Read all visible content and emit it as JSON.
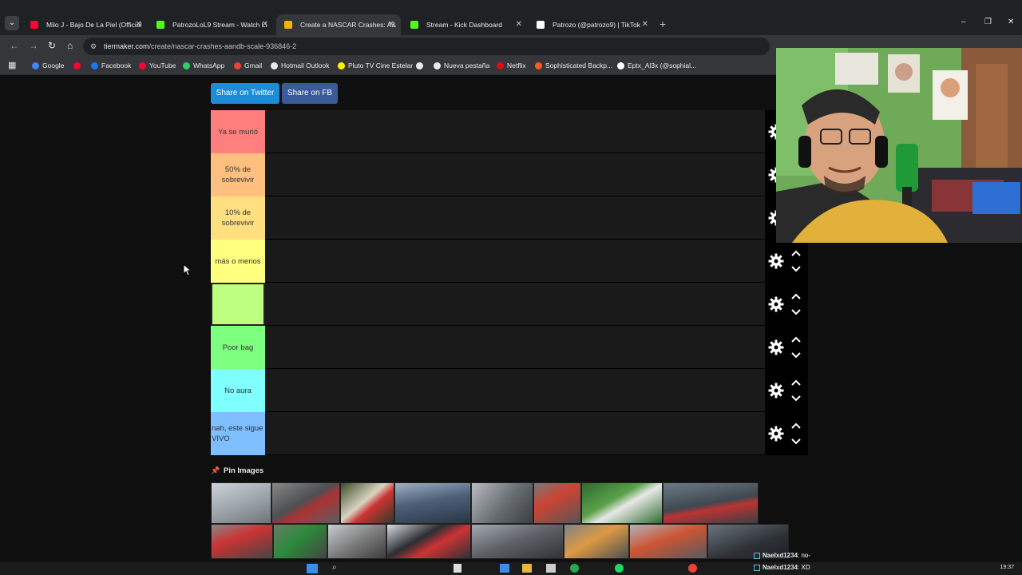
{
  "browser": {
    "tabs": [
      {
        "label": "Milo J - Bajo De La Piel (Official",
        "color": "#ff0033",
        "active": false
      },
      {
        "label": "PatrozoLoL9 Stream - Watch Li",
        "color": "#53fc18",
        "active": false
      },
      {
        "label": "Create a NASCAR Crashes: A&",
        "color": "#f0b400",
        "active": true
      },
      {
        "label": "Stream - Kick Dashboard",
        "color": "#53fc18",
        "active": false
      },
      {
        "label": "Patrozo (@patrozo9) | TikTok",
        "color": "#ffffff",
        "active": false
      }
    ],
    "url_host": "tiermaker.com",
    "url_path": "/create/nascar-crashes-aandb-scale-936846-2",
    "bookmarks": [
      {
        "label": "Google",
        "color": "#4285f4"
      },
      {
        "label": "",
        "color": "#ff0033"
      },
      {
        "label": "Facebook",
        "color": "#1877f2"
      },
      {
        "label": "YouTube",
        "color": "#ff0033"
      },
      {
        "label": "WhatsApp",
        "color": "#25d366"
      },
      {
        "label": "Gmail",
        "color": "#ea4335"
      },
      {
        "label": "Hotmail Outlook",
        "color": "#e8eaed"
      },
      {
        "label": "Pluto TV Cine Estelar",
        "color": "#fff200"
      },
      {
        "label": "",
        "color": "#e8eaed"
      },
      {
        "label": "Nueva pestaña",
        "color": "#e8eaed"
      },
      {
        "label": "Netflix",
        "color": "#e50914"
      },
      {
        "label": "Sophisticated Backp...",
        "color": "#ff5a1f"
      },
      {
        "label": "Eptx_Al3x (@sophial...",
        "color": "#ffffff"
      }
    ]
  },
  "page": {
    "share_twitter": "Share on Twitter",
    "share_fb": "Share on FB",
    "tiers": [
      {
        "label": "Ya se murió",
        "color": "#ff7f7f"
      },
      {
        "label": "50% de sobrevivir",
        "color": "#ffbf7f"
      },
      {
        "label": "10% de sobrevivir",
        "color": "#ffdf7f"
      },
      {
        "label": "más o menos",
        "color": "#ffff7f"
      },
      {
        "label": "",
        "color": "#bfff7f"
      },
      {
        "label": "Poor bag",
        "color": "#7fff7f"
      },
      {
        "label": "No aura",
        "color": "#7fffff"
      },
      {
        "label": "nah, este sigue VIVO",
        "color": "#7fbfff"
      }
    ],
    "pin_images_label": "Pin Images"
  },
  "chat": [
    {
      "user": "Naelxd1234",
      "message": ": no-"
    },
    {
      "user": "Naelxd1234",
      "message": ": XD"
    }
  ],
  "taskbar": {
    "clock": "19:37"
  }
}
